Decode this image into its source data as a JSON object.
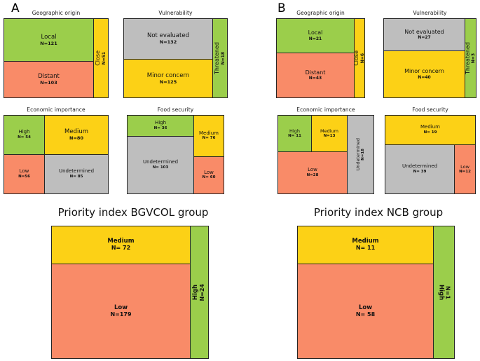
{
  "figure": {
    "groups": [
      {
        "letter": "A",
        "name": "BGVCOL",
        "panels": [
          {
            "title": "Geographic origin",
            "tiles": [
              {
                "label": "Local",
                "count": "N=121",
                "color": "#9BCE4B",
                "orient": "h"
              },
              {
                "label": "Distant",
                "count": "N=103",
                "color": "#F98B68",
                "orient": "h"
              },
              {
                "label": "Close",
                "count": "N=51",
                "color": "#FCD116",
                "orient": "v"
              }
            ]
          },
          {
            "title": "Vulnerability",
            "tiles": [
              {
                "label": "Not evaluated",
                "count": "N=132",
                "color": "#BEBEBE",
                "orient": "h"
              },
              {
                "label": "Minor concern",
                "count": "N=125",
                "color": "#FCD116",
                "orient": "h"
              },
              {
                "label": "Threatened",
                "count": "N=18",
                "color": "#9BCE4B",
                "orient": "v"
              }
            ]
          },
          {
            "title": "Economic importance",
            "tiles": [
              {
                "label": "High",
                "count": "N= 54",
                "color": "#9BCE4B",
                "orient": "h"
              },
              {
                "label": "Medium",
                "count": "N=80",
                "color": "#FCD116",
                "orient": "h"
              },
              {
                "label": "Low",
                "count": "N=56",
                "color": "#F98B68",
                "orient": "h"
              },
              {
                "label": "Undetermined",
                "count": "N= 85",
                "color": "#BEBEBE",
                "orient": "h"
              }
            ]
          },
          {
            "title": "Food security",
            "tiles": [
              {
                "label": "High",
                "count": "N= 36",
                "color": "#9BCE4B",
                "orient": "h"
              },
              {
                "label": "Undetermined",
                "count": "N= 103",
                "color": "#BEBEBE",
                "orient": "h"
              },
              {
                "label": "Medium",
                "count": "N= 76",
                "color": "#FCD116",
                "orient": "h"
              },
              {
                "label": "Low",
                "count": "N= 60",
                "color": "#F98B68",
                "orient": "h"
              }
            ]
          }
        ],
        "priority": {
          "title": "Priority index  BGVCOL group",
          "tiles": [
            {
              "label": "Medium",
              "count": "N= 72",
              "color": "#FCD116",
              "orient": "h"
            },
            {
              "label": "Low",
              "count": "N=179",
              "color": "#F98B68",
              "orient": "h"
            },
            {
              "label": "High",
              "count": "N=24",
              "color": "#9BCE4B",
              "orient": "v"
            }
          ]
        }
      },
      {
        "letter": "B",
        "name": "NCB",
        "panels": [
          {
            "title": "Geographic origin",
            "tiles": [
              {
                "label": "Local",
                "count": "N=21",
                "color": "#9BCE4B",
                "orient": "h"
              },
              {
                "label": "Distant",
                "count": "N=43",
                "color": "#F98B68",
                "orient": "h"
              },
              {
                "label": "Close",
                "count": "N=6",
                "color": "#FCD116",
                "orient": "v"
              }
            ]
          },
          {
            "title": "Vulnerability",
            "tiles": [
              {
                "label": "Not evaluated",
                "count": "N=27",
                "color": "#BEBEBE",
                "orient": "h"
              },
              {
                "label": "Minor concern",
                "count": "N=40",
                "color": "#FCD116",
                "orient": "h"
              },
              {
                "label": "Threatened",
                "count": "N=3",
                "color": "#9BCE4B",
                "orient": "v"
              }
            ]
          },
          {
            "title": "Economic importance",
            "tiles": [
              {
                "label": "High",
                "count": "N= 11",
                "color": "#9BCE4B",
                "orient": "h"
              },
              {
                "label": "Medium",
                "count": "N=13",
                "color": "#FCD116",
                "orient": "h"
              },
              {
                "label": "Low",
                "count": "N=28",
                "color": "#F98B68",
                "orient": "h"
              },
              {
                "label": "Undetermined",
                "count": "N=18",
                "color": "#BEBEBE",
                "orient": "v"
              }
            ]
          },
          {
            "title": "Food security",
            "tiles": [
              {
                "label": "Medium",
                "count": "N= 19",
                "color": "#FCD116",
                "orient": "h"
              },
              {
                "label": "Undetermined",
                "count": "N= 39",
                "color": "#BEBEBE",
                "orient": "h"
              },
              {
                "label": "Low",
                "count": "N=12",
                "color": "#F98B68",
                "orient": "h"
              }
            ]
          }
        ],
        "priority": {
          "title": "Priority index NCB group",
          "tiles": [
            {
              "label": "Medium",
              "count": "N= 11",
              "color": "#FCD116",
              "orient": "h"
            },
            {
              "label": "Low",
              "count": "N= 58",
              "color": "#F98B68",
              "orient": "h"
            },
            {
              "label": "High",
              "count": "N=1",
              "color": "#9BCE4B",
              "orient": "v"
            }
          ]
        }
      }
    ]
  },
  "chart_data": {
    "type": "bar",
    "title": "Mosaic plots of accession characteristics for BGVCOL and NCB groups",
    "subtitle": "",
    "xlabel": "",
    "ylabel": "",
    "grid": false,
    "legend": "none",
    "colors": {
      "green": "#9BCE4B",
      "yellow": "#FCD116",
      "orange": "#F98B68",
      "grey": "#BEBEBE",
      "outline": "#262626",
      "text": "#111111"
    },
    "panels": [
      {
        "group": "A",
        "group_name": "BGVCOL",
        "title": "Geographic origin",
        "categories": [
          "Local",
          "Distant",
          "Close"
        ],
        "values": [
          121,
          103,
          51
        ]
      },
      {
        "group": "A",
        "group_name": "BGVCOL",
        "title": "Vulnerability",
        "categories": [
          "Not evaluated",
          "Minor concern",
          "Threatened"
        ],
        "values": [
          132,
          125,
          18
        ]
      },
      {
        "group": "A",
        "group_name": "BGVCOL",
        "title": "Economic importance",
        "categories": [
          "High",
          "Medium",
          "Low",
          "Undetermined"
        ],
        "values": [
          54,
          80,
          56,
          85
        ]
      },
      {
        "group": "A",
        "group_name": "BGVCOL",
        "title": "Food security",
        "categories": [
          "High",
          "Undetermined",
          "Medium",
          "Low"
        ],
        "values": [
          36,
          103,
          76,
          60
        ]
      },
      {
        "group": "A",
        "group_name": "BGVCOL",
        "title": "Priority index  BGVCOL group",
        "categories": [
          "Medium",
          "Low",
          "High"
        ],
        "values": [
          72,
          179,
          24
        ]
      },
      {
        "group": "B",
        "group_name": "NCB",
        "title": "Geographic origin",
        "categories": [
          "Local",
          "Distant",
          "Close"
        ],
        "values": [
          21,
          43,
          6
        ]
      },
      {
        "group": "B",
        "group_name": "NCB",
        "title": "Vulnerability",
        "categories": [
          "Not evaluated",
          "Minor concern",
          "Threatened"
        ],
        "values": [
          27,
          40,
          3
        ]
      },
      {
        "group": "B",
        "group_name": "NCB",
        "title": "Economic importance",
        "categories": [
          "High",
          "Medium",
          "Low",
          "Undetermined"
        ],
        "values": [
          11,
          13,
          28,
          18
        ]
      },
      {
        "group": "B",
        "group_name": "NCB",
        "title": "Food security",
        "categories": [
          "Medium",
          "Undetermined",
          "Low"
        ],
        "values": [
          19,
          39,
          12
        ]
      },
      {
        "group": "B",
        "group_name": "NCB",
        "title": "Priority index NCB group",
        "categories": [
          "Medium",
          "Low",
          "High"
        ],
        "values": [
          11,
          58,
          1
        ]
      }
    ]
  }
}
